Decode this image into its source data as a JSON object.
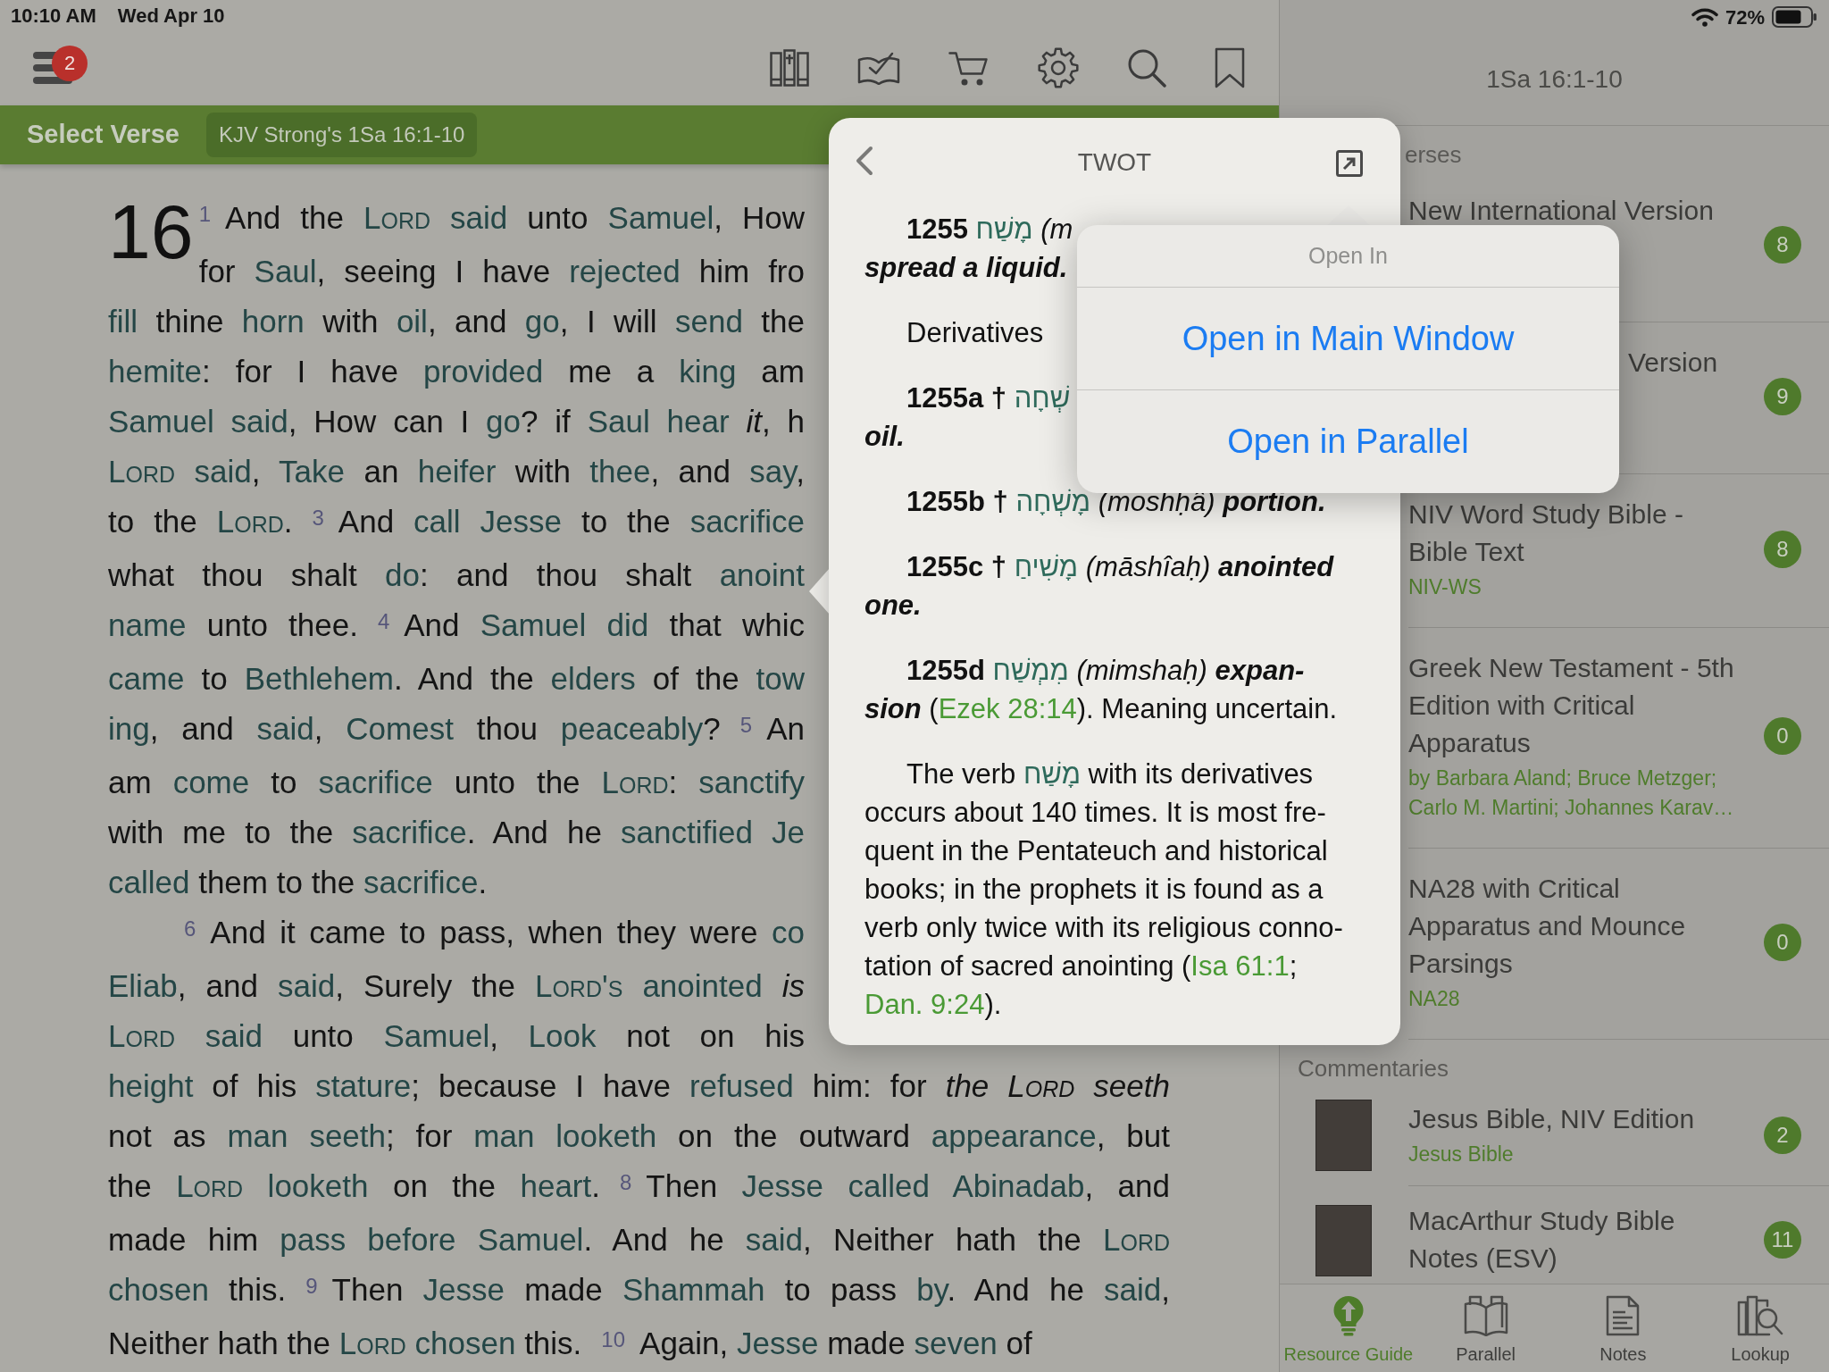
{
  "status_bar": {
    "time": "10:10 AM",
    "date": "Wed Apr 10",
    "battery": "72%"
  },
  "toolbar": {
    "notification_count": "2"
  },
  "verse_bar": {
    "button": "Select Verse",
    "reference": "KJV Strong's 1Sa 16:1-10"
  },
  "passage": {
    "chapter": "16",
    "paragraphs": [
      {
        "lines": [
          [
            {
              "text": "1",
              "kind": "verse"
            },
            {
              "text": "And the ",
              "kind": "plain"
            },
            {
              "text": "Lord",
              "kind": "caps"
            },
            {
              "text": " said",
              "kind": "link"
            },
            {
              "text": " unto ",
              "kind": "plain"
            },
            {
              "text": "Samuel",
              "kind": "link"
            },
            {
              "text": ", How",
              "kind": "plain"
            }
          ],
          [
            {
              "text": "for ",
              "kind": "plain"
            },
            {
              "text": "Saul",
              "kind": "link"
            },
            {
              "text": ", seeing I have ",
              "kind": "plain"
            },
            {
              "text": "rejected",
              "kind": "link"
            },
            {
              "text": " him fro",
              "kind": "plain"
            }
          ],
          [
            {
              "text": "fill",
              "kind": "link"
            },
            {
              "text": " thine ",
              "kind": "plain"
            },
            {
              "text": "horn",
              "kind": "link"
            },
            {
              "text": " with ",
              "kind": "plain"
            },
            {
              "text": "oil",
              "kind": "link"
            },
            {
              "text": ", and ",
              "kind": "plain"
            },
            {
              "text": "go",
              "kind": "link"
            },
            {
              "text": ", I will ",
              "kind": "plain"
            },
            {
              "text": "send",
              "kind": "link"
            },
            {
              "text": " the",
              "kind": "plain"
            }
          ],
          [
            {
              "text": "hemite",
              "kind": "link"
            },
            {
              "text": ": for I have ",
              "kind": "plain"
            },
            {
              "text": "provided",
              "kind": "link"
            },
            {
              "text": " me a ",
              "kind": "plain"
            },
            {
              "text": "king",
              "kind": "link"
            },
            {
              "text": " am",
              "kind": "plain"
            }
          ],
          [
            {
              "text": "Samuel said",
              "kind": "link"
            },
            {
              "text": ", How can I ",
              "kind": "plain"
            },
            {
              "text": "go",
              "kind": "link"
            },
            {
              "text": "? if ",
              "kind": "plain"
            },
            {
              "text": "Saul hear",
              "kind": "link"
            },
            {
              "text": " it",
              "kind": "italic"
            },
            {
              "text": ", h",
              "kind": "plain"
            }
          ],
          [
            {
              "text": "Lord",
              "kind": "caps"
            },
            {
              "text": " said",
              "kind": "link"
            },
            {
              "text": ", ",
              "kind": "plain"
            },
            {
              "text": "Take",
              "kind": "link"
            },
            {
              "text": " an ",
              "kind": "plain"
            },
            {
              "text": "heifer",
              "kind": "link"
            },
            {
              "text": " with ",
              "kind": "plain"
            },
            {
              "text": "thee",
              "kind": "link"
            },
            {
              "text": ", and ",
              "kind": "plain"
            },
            {
              "text": "say",
              "kind": "link"
            },
            {
              "text": ",",
              "kind": "plain"
            }
          ],
          [
            {
              "text": "to the ",
              "kind": "plain"
            },
            {
              "text": "Lord",
              "kind": "caps"
            },
            {
              "text": ".",
              "kind": "plain"
            },
            {
              "text": "3",
              "kind": "verse"
            },
            {
              "text": "And ",
              "kind": "plain"
            },
            {
              "text": "call Jesse",
              "kind": "link"
            },
            {
              "text": " to the ",
              "kind": "plain"
            },
            {
              "text": "sacrifice",
              "kind": "link"
            }
          ],
          [
            {
              "text": "what thou shalt ",
              "kind": "plain"
            },
            {
              "text": "do",
              "kind": "link"
            },
            {
              "text": ": and thou shalt ",
              "kind": "plain"
            },
            {
              "text": "anoint",
              "kind": "link"
            }
          ],
          [
            {
              "text": "name",
              "kind": "link"
            },
            {
              "text": " unto thee.",
              "kind": "plain"
            },
            {
              "text": "4",
              "kind": "verse"
            },
            {
              "text": "And ",
              "kind": "plain"
            },
            {
              "text": "Samuel did",
              "kind": "link"
            },
            {
              "text": " that whic",
              "kind": "plain"
            }
          ],
          [
            {
              "text": "came",
              "kind": "link"
            },
            {
              "text": " to ",
              "kind": "plain"
            },
            {
              "text": "Bethlehem",
              "kind": "link"
            },
            {
              "text": ". And the ",
              "kind": "plain"
            },
            {
              "text": "elders",
              "kind": "link"
            },
            {
              "text": " of the ",
              "kind": "plain"
            },
            {
              "text": "tow",
              "kind": "link"
            }
          ],
          [
            {
              "text": "ing",
              "kind": "link"
            },
            {
              "text": ", and ",
              "kind": "plain"
            },
            {
              "text": "said",
              "kind": "link"
            },
            {
              "text": ", ",
              "kind": "plain"
            },
            {
              "text": "Comest",
              "kind": "link"
            },
            {
              "text": " thou ",
              "kind": "plain"
            },
            {
              "text": "peaceably",
              "kind": "link"
            },
            {
              "text": "?",
              "kind": "plain"
            },
            {
              "text": "5",
              "kind": "verse"
            },
            {
              "text": "An",
              "kind": "plain"
            }
          ],
          [
            {
              "text": "am ",
              "kind": "plain"
            },
            {
              "text": "come",
              "kind": "link"
            },
            {
              "text": " to ",
              "kind": "plain"
            },
            {
              "text": "sacrifice",
              "kind": "link"
            },
            {
              "text": " unto the ",
              "kind": "plain"
            },
            {
              "text": "Lord",
              "kind": "caps"
            },
            {
              "text": ": ",
              "kind": "plain"
            },
            {
              "text": "sanctify",
              "kind": "link"
            }
          ],
          [
            {
              "text": "with me to the ",
              "kind": "plain"
            },
            {
              "text": "sacrifice",
              "kind": "link"
            },
            {
              "text": ". And he ",
              "kind": "plain"
            },
            {
              "text": "sanctified",
              "kind": "link"
            },
            {
              "text": " Je",
              "kind": "link"
            }
          ],
          [
            {
              "text": "called",
              "kind": "link"
            },
            {
              "text": " them to the ",
              "kind": "plain"
            },
            {
              "text": "sacrifice",
              "kind": "link"
            },
            {
              "text": ".",
              "kind": "plain"
            }
          ]
        ]
      },
      {
        "lines": [
          [
            {
              "text": "6",
              "kind": "verse"
            },
            {
              "text": "And it came to pass, when they were ",
              "kind": "plain"
            },
            {
              "text": "co",
              "kind": "link"
            }
          ],
          [
            {
              "text": "Eliab",
              "kind": "link"
            },
            {
              "text": ", and ",
              "kind": "plain"
            },
            {
              "text": "said",
              "kind": "link"
            },
            {
              "text": ", Surely the ",
              "kind": "plain"
            },
            {
              "text": "Lord's",
              "kind": "caps"
            },
            {
              "text": " anointed",
              "kind": "link"
            },
            {
              "text": " is",
              "kind": "italic"
            }
          ],
          [
            {
              "text": "Lord",
              "kind": "caps"
            },
            {
              "text": " said",
              "kind": "link"
            },
            {
              "text": " unto ",
              "kind": "plain"
            },
            {
              "text": "Samuel",
              "kind": "link"
            },
            {
              "text": ", ",
              "kind": "plain"
            },
            {
              "text": "Look",
              "kind": "link"
            },
            {
              "text": " not on his",
              "kind": "plain"
            }
          ],
          [
            {
              "text": "height",
              "kind": "link"
            },
            {
              "text": " of his ",
              "kind": "plain"
            },
            {
              "text": "stature",
              "kind": "link"
            },
            {
              "text": "; because I have ",
              "kind": "plain"
            },
            {
              "text": "refused",
              "kind": "link"
            },
            {
              "text": " him: for ",
              "kind": "plain"
            },
            {
              "text": "the ",
              "kind": "italic"
            },
            {
              "text": "Lord",
              "kind": "caps-italic"
            },
            {
              "text": " seeth",
              "kind": "italic"
            }
          ],
          [
            {
              "text": "not as ",
              "kind": "plain"
            },
            {
              "text": "man seeth",
              "kind": "link"
            },
            {
              "text": "; for ",
              "kind": "plain"
            },
            {
              "text": "man looketh",
              "kind": "link"
            },
            {
              "text": " on the outward ",
              "kind": "plain"
            },
            {
              "text": "appearance",
              "kind": "link"
            },
            {
              "text": ", but",
              "kind": "plain"
            }
          ],
          [
            {
              "text": "the ",
              "kind": "plain"
            },
            {
              "text": "Lord",
              "kind": "caps"
            },
            {
              "text": " looketh",
              "kind": "link"
            },
            {
              "text": " on the ",
              "kind": "plain"
            },
            {
              "text": "heart",
              "kind": "link"
            },
            {
              "text": ".",
              "kind": "plain"
            },
            {
              "text": "8",
              "kind": "verse"
            },
            {
              "text": "Then ",
              "kind": "plain"
            },
            {
              "text": "Jesse called Abinadab",
              "kind": "link"
            },
            {
              "text": ", and",
              "kind": "plain"
            }
          ],
          [
            {
              "text": "made him ",
              "kind": "plain"
            },
            {
              "text": "pass before Samuel",
              "kind": "link"
            },
            {
              "text": ". And he ",
              "kind": "plain"
            },
            {
              "text": "said",
              "kind": "link"
            },
            {
              "text": ", Neither hath the ",
              "kind": "plain"
            },
            {
              "text": "Lord",
              "kind": "caps"
            }
          ],
          [
            {
              "text": "chosen",
              "kind": "link"
            },
            {
              "text": " this.",
              "kind": "plain"
            },
            {
              "text": "9",
              "kind": "verse"
            },
            {
              "text": "Then ",
              "kind": "plain"
            },
            {
              "text": "Jesse",
              "kind": "link"
            },
            {
              "text": " made ",
              "kind": "plain"
            },
            {
              "text": "Shammah",
              "kind": "link"
            },
            {
              "text": " to pass ",
              "kind": "plain"
            },
            {
              "text": "by",
              "kind": "link"
            },
            {
              "text": ". And he ",
              "kind": "plain"
            },
            {
              "text": "said",
              "kind": "link"
            },
            {
              "text": ",",
              "kind": "plain"
            }
          ],
          [
            {
              "text": "Neither hath the ",
              "kind": "plain"
            },
            {
              "text": "Lord",
              "kind": "caps"
            },
            {
              "text": " chosen",
              "kind": "link"
            },
            {
              "text": " this.",
              "kind": "plain"
            },
            {
              "text": "10",
              "kind": "verse"
            },
            {
              "text": "Again, ",
              "kind": "plain"
            },
            {
              "text": "Jesse",
              "kind": "link"
            },
            {
              "text": " made ",
              "kind": "plain"
            },
            {
              "text": "seven",
              "kind": "link"
            },
            {
              "text": " of",
              "kind": "plain"
            }
          ]
        ]
      }
    ]
  },
  "twot_popover": {
    "title": "TWOT",
    "entries": [
      {
        "lines": [
          [
            {
              "text": "1255 ",
              "kind": "bold"
            },
            {
              "text": "מָשַׁח",
              "kind": "hebrew"
            },
            {
              "text": " (m",
              "kind": "italic"
            }
          ],
          [
            {
              "text": "spread a liquid.",
              "kind": "bold-italic"
            }
          ]
        ]
      },
      {
        "lines": [
          [
            {
              "text": "Derivatives",
              "kind": "plain"
            }
          ]
        ]
      },
      {
        "lines": [
          [
            {
              "text": "1255a † ",
              "kind": "bold"
            },
            {
              "text": "שְׁחָה",
              "kind": "hebrew"
            }
          ],
          [
            {
              "text": "oil.",
              "kind": "bold-italic"
            }
          ]
        ]
      },
      {
        "lines": [
          [
            {
              "text": "1255b † ",
              "kind": "bold"
            },
            {
              "text": "מָשְׁחָה",
              "kind": "hebrew"
            },
            {
              "text": " (moshḥâ)",
              "kind": "italic"
            },
            {
              "text": " portion.",
              "kind": "bold-italic"
            }
          ]
        ]
      },
      {
        "lines": [
          [
            {
              "text": "1255c † ",
              "kind": "bold"
            },
            {
              "text": "מָשִׁיחַ",
              "kind": "hebrew"
            },
            {
              "text": " (māshîaḥ)",
              "kind": "italic"
            },
            {
              "text": " anointed",
              "kind": "bold-italic"
            }
          ],
          [
            {
              "text": "one.",
              "kind": "bold-italic"
            }
          ]
        ]
      },
      {
        "lines": [
          [
            {
              "text": "1255d ",
              "kind": "bold"
            },
            {
              "text": "מִמְשַׁח",
              "kind": "hebrew"
            },
            {
              "text": " (mimshaḥ)",
              "kind": "italic"
            },
            {
              "text": " expan-",
              "kind": "bold-italic"
            }
          ],
          [
            {
              "text": "sion",
              "kind": "bold-italic"
            },
            {
              "text": " (",
              "kind": "plain"
            },
            {
              "text": "Ezek 28:14",
              "kind": "link"
            },
            {
              "text": "). Meaning uncertain.",
              "kind": "plain"
            }
          ]
        ]
      },
      {
        "lines": [
          [
            {
              "text": "The verb ",
              "kind": "plain"
            },
            {
              "text": "מָשַׁח",
              "kind": "hebrew"
            },
            {
              "text": " with its derivatives",
              "kind": "plain"
            }
          ],
          [
            {
              "text": "occurs about 140 times. It is most fre-",
              "kind": "plain"
            }
          ],
          [
            {
              "text": "quent in the Pentateuch and historical",
              "kind": "plain"
            }
          ],
          [
            {
              "text": "books; in the prophets it is found as a",
              "kind": "plain"
            }
          ],
          [
            {
              "text": "verb only twice with its religious conno-",
              "kind": "plain"
            }
          ],
          [
            {
              "text": "tation of sacred anointing (",
              "kind": "plain"
            },
            {
              "text": "Isa 61:1",
              "kind": "link"
            },
            {
              "text": ";",
              "kind": "plain"
            }
          ],
          [
            {
              "text": "Dan. 9:24",
              "kind": "link"
            },
            {
              "text": ").",
              "kind": "plain"
            }
          ]
        ]
      }
    ]
  },
  "open_in_menu": {
    "title": "Open In",
    "options": [
      "Open in Main Window",
      "Open in Parallel"
    ]
  },
  "sidebar": {
    "title": "1Sa 16:1-10",
    "sections": [
      {
        "title": "erses",
        "kind": "covered",
        "items": [
          {
            "kind": "resource",
            "title": "New International Version",
            "count": "8"
          },
          {
            "kind": "covered",
            "title": "Version",
            "count": "9"
          },
          {
            "kind": "resource",
            "title": "NIV Word Study Bible - Bible Text",
            "subtitle": "NIV-WS",
            "count": "8"
          },
          {
            "kind": "resource",
            "title": "Greek New Testament - 5th Edition with Critical Apparatus",
            "subtitle": "by Barbara Aland; Bruce Metzger; Carlo M. Martini; Johannes Karav…",
            "count": "0"
          },
          {
            "kind": "resource",
            "title": "NA28 with Critical Apparatus and Mounce Parsings",
            "subtitle": "NA28",
            "count": "0"
          }
        ]
      },
      {
        "title": "Commentaries",
        "kind": "plain",
        "items": [
          {
            "kind": "cover",
            "title": "Jesus Bible, NIV Edition",
            "subtitle": "Jesus Bible",
            "count": "2"
          },
          {
            "kind": "cover",
            "title": "MacArthur Study Bible Notes (ESV)",
            "count": "11"
          }
        ]
      }
    ]
  },
  "tab_bar": [
    {
      "label": "Resource Guide",
      "selected": true
    },
    {
      "label": "Parallel",
      "selected": false
    },
    {
      "label": "Notes",
      "selected": false
    },
    {
      "label": "Lookup",
      "selected": false
    }
  ]
}
